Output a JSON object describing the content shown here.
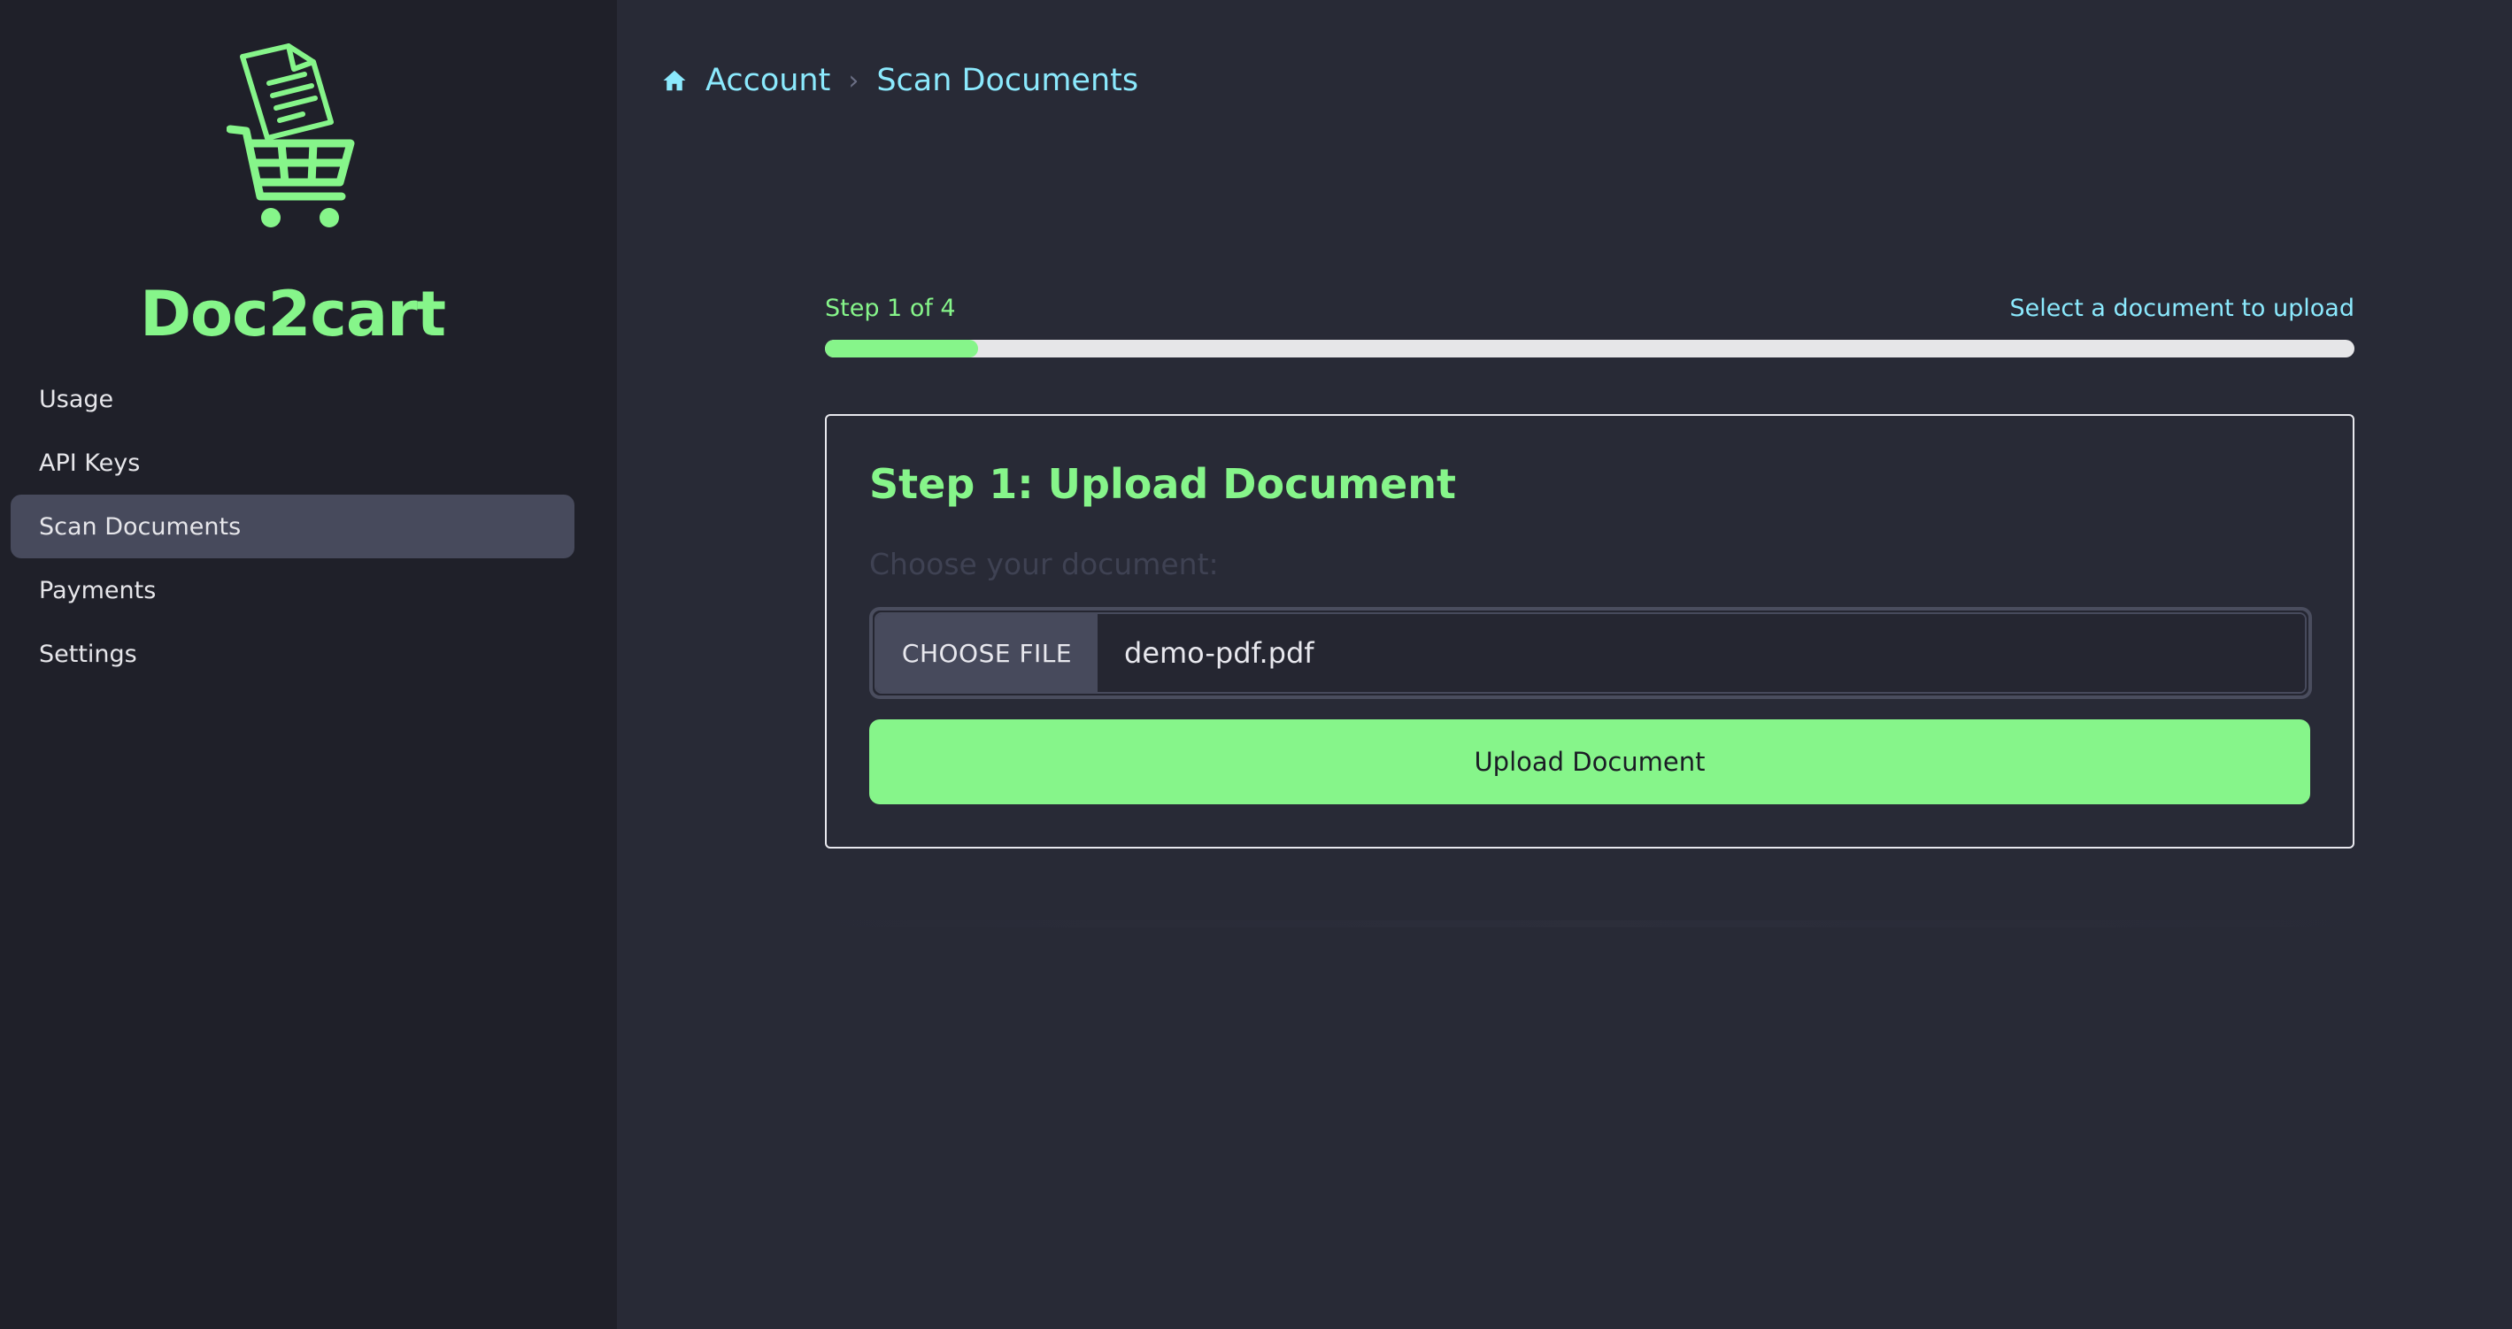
{
  "brand": {
    "name": "Doc2cart",
    "logo_icon": "document-cart-logo-icon",
    "accent_color": "#86f58a"
  },
  "sidebar": {
    "items": [
      {
        "label": "Usage",
        "active": false
      },
      {
        "label": "API Keys",
        "active": false
      },
      {
        "label": "Scan Documents",
        "active": true
      },
      {
        "label": "Payments",
        "active": false
      },
      {
        "label": "Settings",
        "active": false
      }
    ]
  },
  "breadcrumb": {
    "home_icon": "home-icon",
    "items": [
      "Account",
      "Scan Documents"
    ],
    "separator": "›",
    "color": "#8be9fd"
  },
  "wizard": {
    "step_label": "Step 1 of 4",
    "step_hint": "Select a document to upload",
    "progress_fraction": 0.1
  },
  "card": {
    "title": "Step 1: Upload Document",
    "field_label": "Choose your document:",
    "choose_button": "CHOOSE FILE",
    "file_name": "demo-pdf.pdf",
    "submit_label": "Upload Document"
  }
}
